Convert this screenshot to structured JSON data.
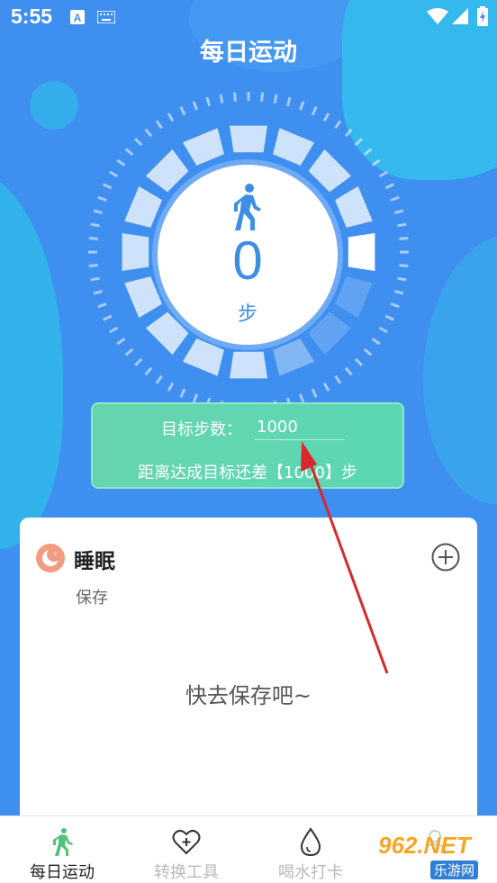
{
  "status_bar": {
    "time": "5:55"
  },
  "header": {
    "title": "每日运动"
  },
  "dial": {
    "steps": "0",
    "unit": "步"
  },
  "goal": {
    "label": "目标步数：",
    "input_value": "1000",
    "remaining_text": "距离达成目标还差【1000】步"
  },
  "sleep": {
    "title": "睡眠",
    "subtitle": "保存",
    "empty_text": "快去保存吧~"
  },
  "nav": {
    "items": [
      {
        "label": "每日运动",
        "icon": "walk-icon",
        "active": true
      },
      {
        "label": "转换工具",
        "icon": "heart-plus-icon",
        "active": false
      },
      {
        "label": "喝水打卡",
        "icon": "water-drop-icon",
        "active": false
      },
      {
        "label": "",
        "icon": "profile-icon",
        "active": false
      }
    ]
  },
  "watermark": {
    "brand": "962.NET",
    "sub": "乐游网"
  },
  "colors": {
    "background": "#3f8ff0",
    "goal_card": "#66d5ad",
    "accent_text": "#3d8fe4",
    "arrow": "#d8282b",
    "nav_active_icon": "#4fc27a"
  }
}
